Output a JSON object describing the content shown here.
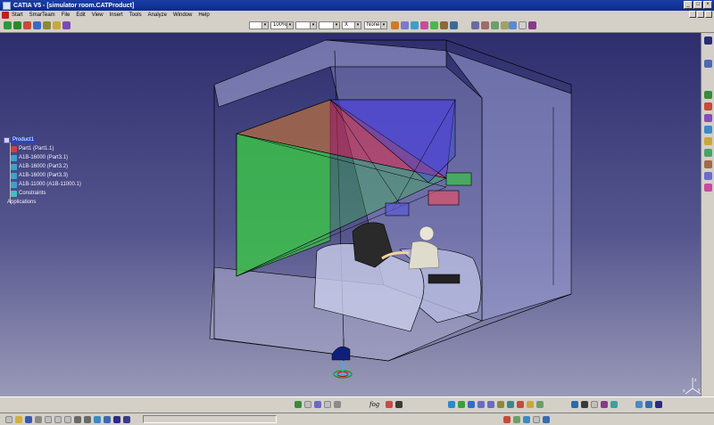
{
  "window": {
    "title": "CATIA V5 - [simulator room.CATProduct]"
  },
  "menubar": {
    "items": [
      "Start",
      "SmarTeam",
      "File",
      "Edit",
      "View",
      "Insert",
      "Tools",
      "Analyze",
      "Window",
      "Help"
    ]
  },
  "properties_toolbar": {
    "color_value": "",
    "transparency_value": "100%",
    "line_thickness_value": "",
    "line_type_value": "",
    "point_symbol_value": "X",
    "layer_value": "None"
  },
  "spec_tree": {
    "root": "Product1",
    "children": [
      "Part1 (Part1.1)",
      "A1B-16000 (Part3.1)",
      "A1B-16000 (Part3.2)",
      "A1B-16000 (Part3.3)",
      "A1B-11000 (A1B-11000.1)",
      "Constraints"
    ],
    "applications": "Applications"
  },
  "compass": {
    "axis_x": "x",
    "axis_y": "y",
    "axis_z": "z"
  },
  "statusbar": {
    "fog_label": "fog"
  },
  "icons": {
    "app": "catia-logo-icon",
    "close": "close-icon",
    "minimize": "minimize-icon",
    "maximize": "maximize-icon"
  }
}
